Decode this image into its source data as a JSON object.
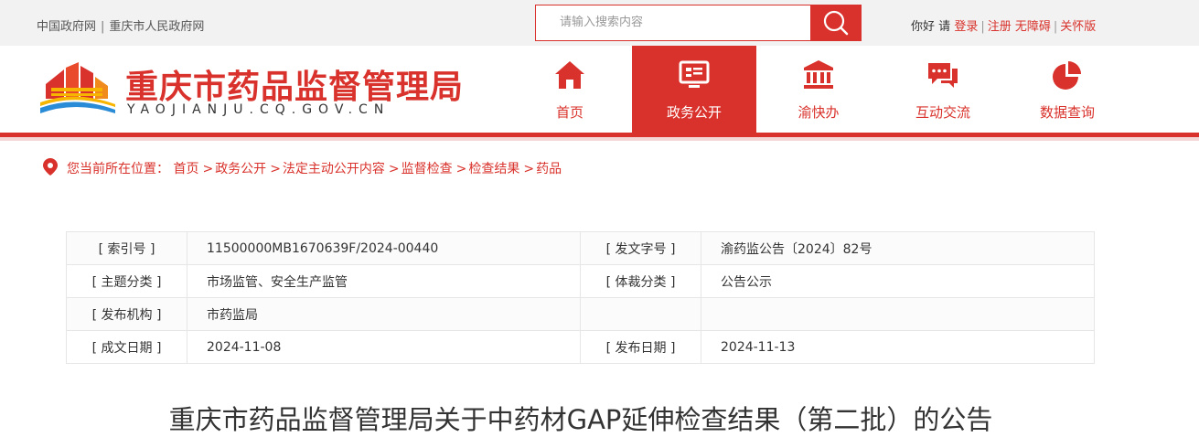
{
  "topbar": {
    "links": [
      "中国政府网",
      "重庆市人民政府网"
    ],
    "search_placeholder": "请输入搜索内容",
    "greeting": "你好",
    "please": "请",
    "login": "登录",
    "register": "注册",
    "accessibility": "无障碍",
    "care_mode": "关怀版"
  },
  "header": {
    "title": "重庆市药品监督管理局",
    "domain": "YAOJIANJU.CQ.GOV.CN"
  },
  "nav": {
    "items": [
      {
        "label": "首页",
        "icon": "home-icon"
      },
      {
        "label": "政务公开",
        "icon": "monitor-icon"
      },
      {
        "label": "渝快办",
        "icon": "building-icon"
      },
      {
        "label": "互动交流",
        "icon": "chat-icon"
      },
      {
        "label": "数据查询",
        "icon": "pie-chart-icon"
      }
    ],
    "active_index": 1
  },
  "breadcrumb": {
    "prefix": "您当前所在位置：",
    "items": [
      "首页",
      "政务公开",
      "法定主动公开内容",
      "监督检查",
      "检查结果",
      "药品"
    ]
  },
  "meta": {
    "rows": [
      {
        "k1": "[ 索引号 ]",
        "v1": "11500000MB1670639F/2024-00440",
        "k2": "[ 发文字号 ]",
        "v2": "渝药监公告〔2024〕82号"
      },
      {
        "k1": "[ 主题分类 ]",
        "v1": "市场监管、安全生产监管",
        "k2": "[ 体裁分类 ]",
        "v2": "公告公示"
      },
      {
        "k1": "[ 发布机构 ]",
        "v1": "市药监局",
        "k2": "",
        "v2": ""
      },
      {
        "k1": "[ 成文日期 ]",
        "v1": "2024-11-08",
        "k2": "[ 发布日期 ]",
        "v2": "2024-11-13"
      }
    ]
  },
  "article": {
    "title": "重庆市药品监督管理局关于中药材GAP延伸检查结果（第二批）的公告"
  },
  "colors": {
    "brand_red": "#d9312b",
    "topbar_bg": "#f2f2f2"
  }
}
